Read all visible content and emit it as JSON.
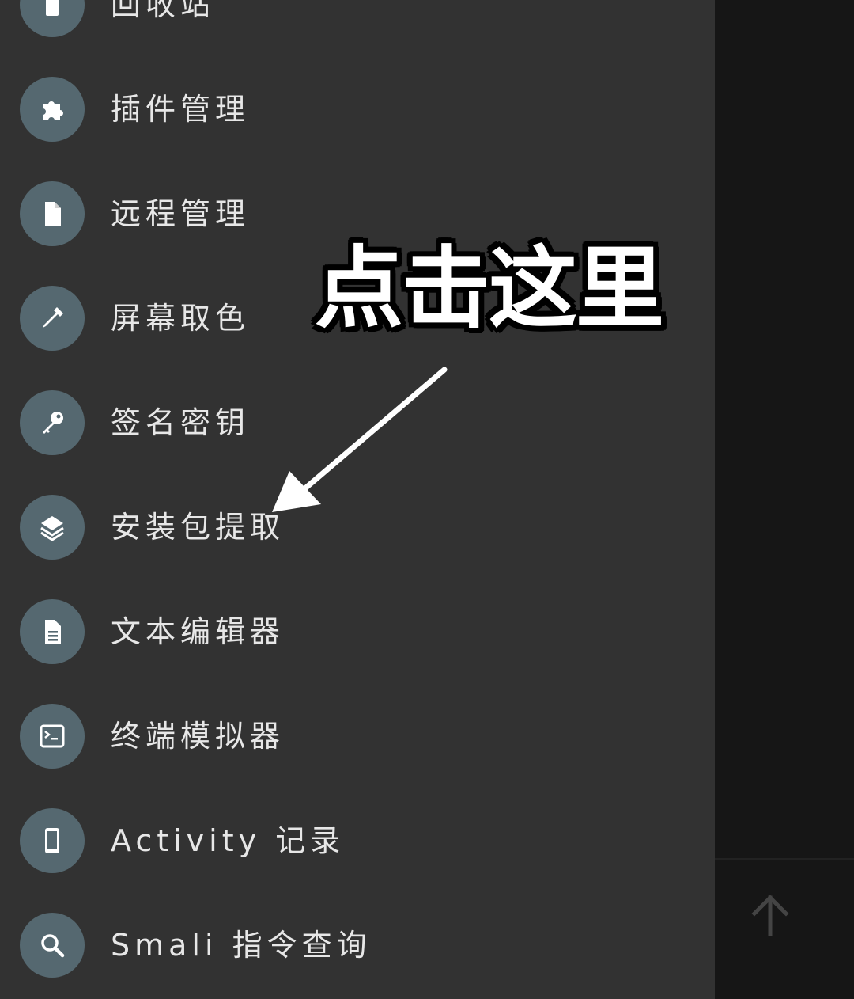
{
  "menu": {
    "items": [
      {
        "label": "回收站",
        "icon": "trash-icon"
      },
      {
        "label": "插件管理",
        "icon": "puzzle-icon"
      },
      {
        "label": "远程管理",
        "icon": "file-icon"
      },
      {
        "label": "屏幕取色",
        "icon": "eyedropper-icon"
      },
      {
        "label": "签名密钥",
        "icon": "key-icon"
      },
      {
        "label": "安装包提取",
        "icon": "layers-icon"
      },
      {
        "label": "文本编辑器",
        "icon": "document-icon"
      },
      {
        "label": "终端模拟器",
        "icon": "terminal-icon"
      },
      {
        "label": "Activity 记录",
        "icon": "phone-icon"
      },
      {
        "label": "Smali 指令查询",
        "icon": "search-icon"
      }
    ]
  },
  "annotation": {
    "text": "点击这里"
  },
  "colors": {
    "drawer_bg": "#323232",
    "icon_circle": "#556870",
    "label_text": "#e7e7e7",
    "right_panel_bg": "#161616"
  }
}
